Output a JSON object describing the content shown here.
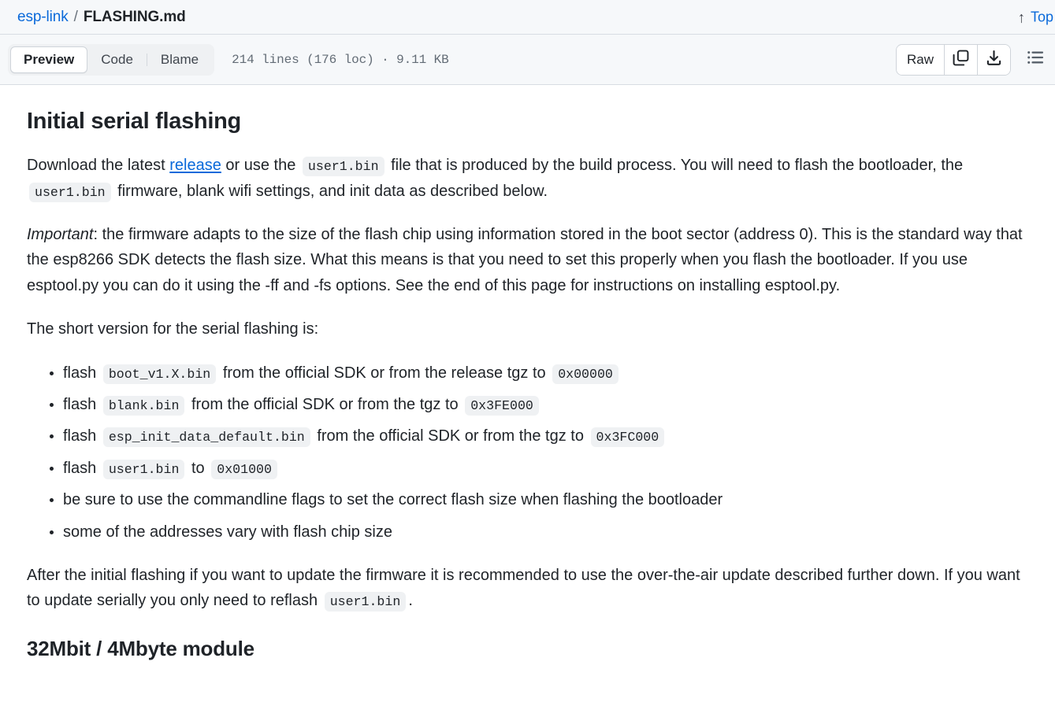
{
  "breadcrumb": {
    "repo": "esp-link",
    "separator": "/",
    "file": "FLASHING.md"
  },
  "top_link": {
    "label": "Top",
    "arrow_glyph": "↑"
  },
  "toolbar": {
    "tabs": [
      {
        "label": "Preview",
        "active": true
      },
      {
        "label": "Code",
        "active": false
      },
      {
        "label": "Blame",
        "active": false
      }
    ],
    "file_meta": "214 lines (176 loc) · 9.11 KB",
    "raw_label": "Raw",
    "icons": {
      "copy": "copy-icon",
      "download": "download-icon",
      "outline": "outline-list-icon"
    }
  },
  "colors": {
    "link": "#0969da",
    "header_bg": "#f6f8fa",
    "code_bg": "#eff1f3",
    "border": "#d8dde3",
    "text": "#1f2328",
    "muted_text": "#636c76"
  },
  "document": {
    "h1": "Initial serial flashing",
    "p1": {
      "a": "Download the latest ",
      "link": "release",
      "b": " or use the ",
      "code1": "user1.bin",
      "c": " file that is produced by the build process. You will need to flash the bootloader, the ",
      "code2": "user1.bin",
      "d": " firmware, blank wifi settings, and init data as described below."
    },
    "p2": {
      "em": "Important",
      "text": ": the firmware adapts to the size of the flash chip using information stored in the boot sector (address 0). This is the standard way that the esp8266 SDK detects the flash size. What this means is that you need to set this properly when you flash the bootloader. If you use esptool.py you can do it using the -ff and -fs options. See the end of this page for instructions on installing esptool.py."
    },
    "p3": "The short version for the serial flashing is:",
    "list": [
      {
        "a": "flash ",
        "code1": "boot_v1.X.bin",
        "b": " from the official SDK or from the release tgz to ",
        "code2": "0x00000",
        "c": ""
      },
      {
        "a": "flash ",
        "code1": "blank.bin",
        "b": " from the official SDK or from the tgz to ",
        "code2": "0x3FE000",
        "c": ""
      },
      {
        "a": "flash ",
        "code1": "esp_init_data_default.bin",
        "b": " from the official SDK or from the tgz to ",
        "code2": "0x3FC000",
        "c": ""
      },
      {
        "a": "flash ",
        "code1": "user1.bin",
        "b": " to ",
        "code2": "0x01000",
        "c": ""
      },
      {
        "a": "be sure to use the commandline flags to set the correct flash size when flashing the bootloader",
        "code1": "",
        "b": "",
        "code2": "",
        "c": ""
      },
      {
        "a": "some of the addresses vary with flash chip size",
        "code1": "",
        "b": "",
        "code2": "",
        "c": ""
      }
    ],
    "p4": {
      "a": "After the initial flashing if you want to update the firmware it is recommended to use the over-the-air update described further down. If you want to update serially you only need to reflash ",
      "code1": "user1.bin",
      "b": "."
    },
    "h2": "32Mbit / 4Mbyte module"
  }
}
